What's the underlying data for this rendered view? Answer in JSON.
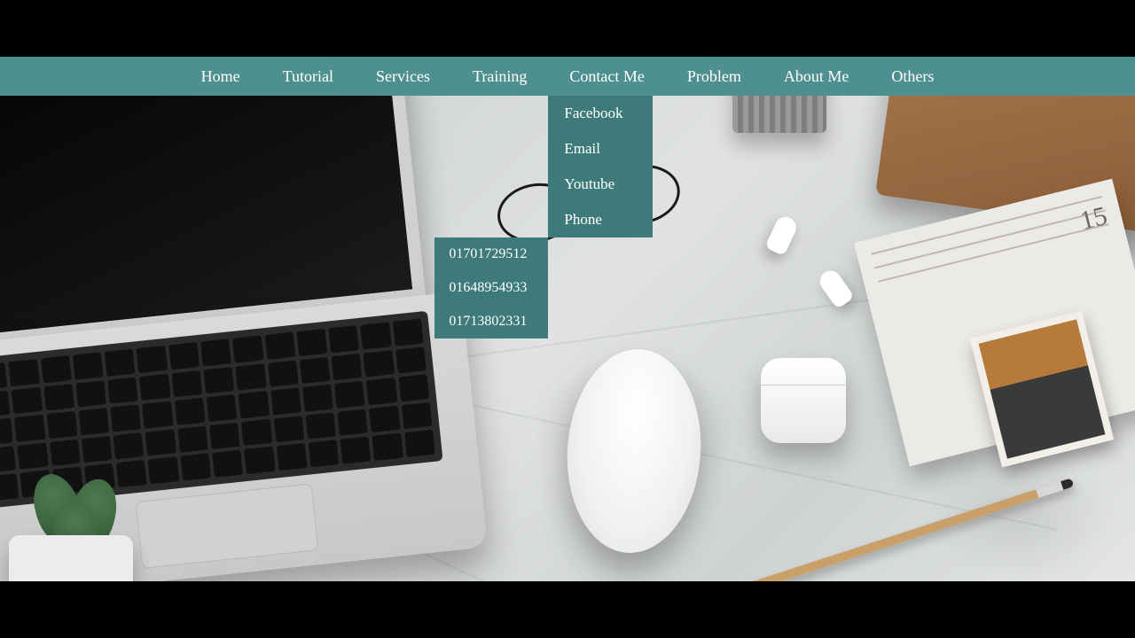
{
  "nav": {
    "items": [
      {
        "label": "Home"
      },
      {
        "label": "Tutorial"
      },
      {
        "label": "Services"
      },
      {
        "label": "Training"
      },
      {
        "label": "Contact Me"
      },
      {
        "label": "Problem"
      },
      {
        "label": "About Me"
      },
      {
        "label": "Others"
      }
    ],
    "contact_submenu": [
      {
        "label": "Facebook"
      },
      {
        "label": "Email"
      },
      {
        "label": "Youtube"
      },
      {
        "label": "Phone"
      }
    ],
    "phone_numbers": [
      {
        "label": "01701729512"
      },
      {
        "label": "01648954933"
      },
      {
        "label": "01713802331"
      }
    ]
  },
  "paper_badge": "15",
  "colors": {
    "navbar": "#4e8f8f",
    "dropdown": "#3f7a7a"
  }
}
